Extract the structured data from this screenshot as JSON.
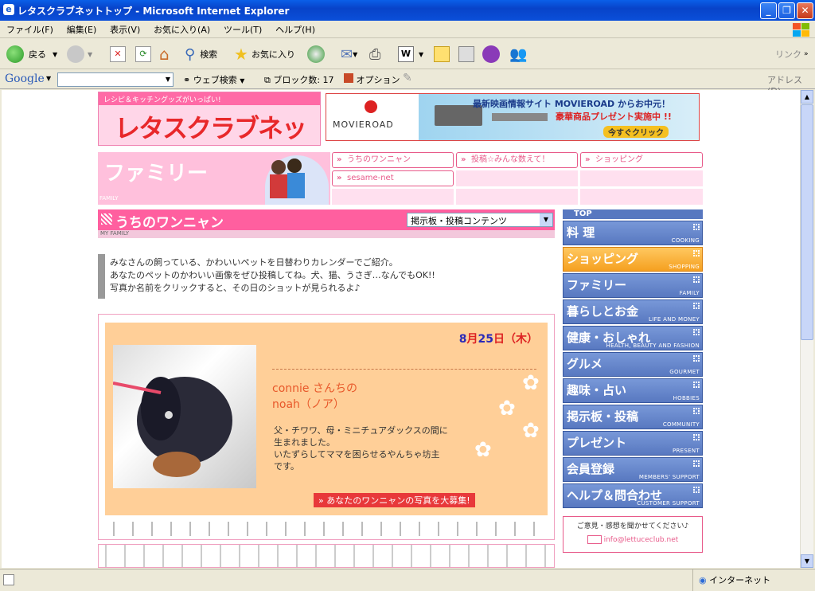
{
  "window": {
    "title": "レタスクラブネットトップ - Microsoft Internet Explorer"
  },
  "menu": [
    "ファイル(F)",
    "編集(E)",
    "表示(V)",
    "お気に入り(A)",
    "ツール(T)",
    "ヘルプ(H)"
  ],
  "toolbar": {
    "back": "戻る",
    "search": "検索",
    "favorites": "お気に入り",
    "links": "リンク"
  },
  "google": {
    "logo": "Google",
    "web_search": "ウェブ検索",
    "blocked": "ブロック数: 17",
    "options": "オプション",
    "address": "アドレス(D)"
  },
  "site": {
    "tagline": "レシピ＆キッチングッズがいっぱい!",
    "logo": "レタスクラブネット",
    "movie_logo": "MOVIEROAD",
    "movie_line1": "最新映画情報サイト MOVIEROAD からお中元！",
    "movie_line2": "豪華商品プレゼント実施中 !!",
    "movie_cta": "今すぐクリック",
    "family_title": "ファミリー",
    "family_en": "FAMILY",
    "nav": [
      "うちのワンニャン",
      "投稿☆みんな数えて！",
      "ショッピング",
      "sesame-net"
    ],
    "section_title": "うちのワンニャン",
    "section_en": "MY FAMILY",
    "select_value": "掲示板・投稿コンテンツ",
    "intro": [
      "みなさんの飼っている、かわいいペットを日替わりカレンダーでご紹介。",
      "あなたのペットのかわいい画像をぜひ投稿してね。犬、猫、うさぎ…なんでもOK!!",
      "写真か名前をクリックすると、その日のショットが見られるよ♪"
    ],
    "date_month": "8",
    "date_month_label": "月",
    "date_day": "25",
    "date_day_label": "日",
    "date_weekday": "（木）",
    "pet_owner": "connie さんちの",
    "pet_name": "noah（ノア）",
    "pet_desc": [
      "父・チワワ、母・ミニチュアダックスの間に",
      "生まれました。",
      "いたずらしてママを困らせるやんちゃ坊主",
      "です。"
    ],
    "recruit": "あなたのワンニャンの写真を大募集!",
    "sidebar_top": "TOP",
    "sidebar": [
      {
        "jp": "料 理",
        "en": "COOKING"
      },
      {
        "jp": "ショッピング",
        "en": "SHOPPING"
      },
      {
        "jp": "ファミリー",
        "en": "FAMILY"
      },
      {
        "jp": "暮らしとお金",
        "en": "LIFE AND MONEY"
      },
      {
        "jp": "健康・おしゃれ",
        "en": "HEALTH, BEAUTY AND FASHION"
      },
      {
        "jp": "グルメ",
        "en": "GOURMET"
      },
      {
        "jp": "趣味・占い",
        "en": "HOBBIES"
      },
      {
        "jp": "掲示板・投稿",
        "en": "COMMUNITY"
      },
      {
        "jp": "プレゼント",
        "en": "PRESENT"
      },
      {
        "jp": "会員登録",
        "en": "MEMBERS' SUPPORT"
      },
      {
        "jp": "ヘルプ＆問合わせ",
        "en": "CUSTOMER SUPPORT"
      }
    ],
    "feedback": "ご意見・感想を聞かせてください♪",
    "email": "info@lettuceclub.net"
  },
  "status": {
    "zone": "インターネット"
  }
}
